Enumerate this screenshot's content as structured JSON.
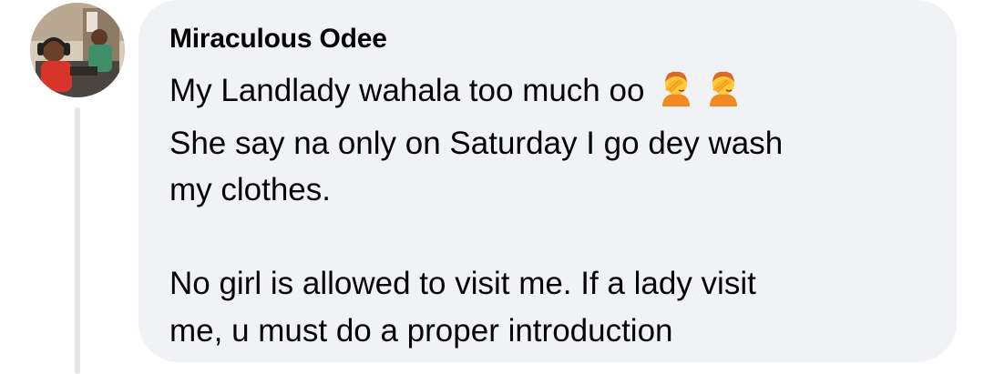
{
  "comment": {
    "author": "Miraculous Odee",
    "line_1": "My Landlady wahala too much oo",
    "body": "She say na only on Saturday I go dey wash\nmy clothes.\n\nNo girl is allowed to visit me. If a lady visit\nme, u must do a proper introduction",
    "emoji_icons": [
      "person-facepalming-icon",
      "person-facepalming-icon"
    ]
  },
  "colors": {
    "bubble_bg": "#f0f2f5",
    "text": "#050505",
    "thread_line": "#e3e5e9"
  }
}
